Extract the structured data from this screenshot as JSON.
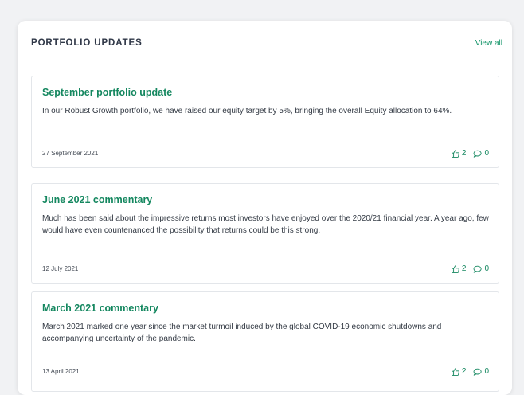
{
  "panel": {
    "title": "PORTFOLIO UPDATES",
    "view_all_label": "View all"
  },
  "posts": [
    {
      "title": "September portfolio update",
      "body": "In our Robust Growth portfolio, we have raised our equity target by 5%, bringing the overall Equity allocation to 64%.",
      "date": "27 September 2021",
      "likes": "2",
      "comments": "0"
    },
    {
      "title": "June 2021 commentary",
      "body": "Much has been said about the impressive returns most investors have enjoyed over the 2020/21 financial year. A year ago, few would have even countenanced the possibility that returns could be this strong.",
      "date": "12 July 2021",
      "likes": "2",
      "comments": "0"
    },
    {
      "title": "March 2021 commentary",
      "body": "March 2021 marked one year since the market turmoil induced by the global COVID-19 economic shutdowns and accompanying uncertainty of the pandemic.",
      "date": "13 April 2021",
      "likes": "2",
      "comments": "0"
    }
  ],
  "icons": {
    "like": "thumbs-up-icon",
    "comment": "comment-bubble-icon"
  },
  "colors": {
    "accent": "#14875f",
    "link": "#129468",
    "heading": "#2f3747",
    "border": "#e3e6ea"
  }
}
